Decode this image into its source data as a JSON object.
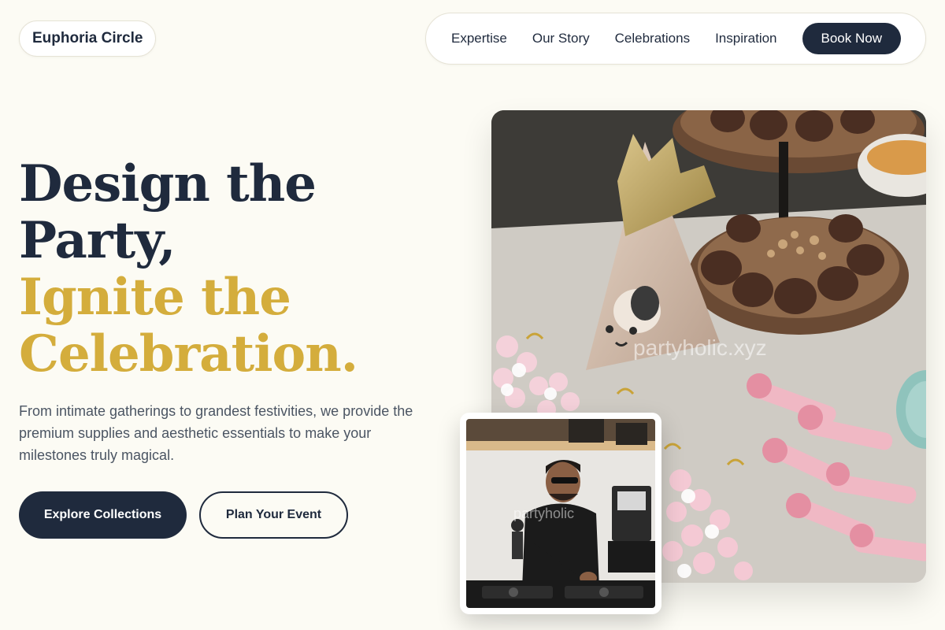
{
  "header": {
    "brand": "Euphoria Circle",
    "nav": [
      "Expertise",
      "Our Story",
      "Celebrations",
      "Inspiration"
    ],
    "cta": "Book Now"
  },
  "hero": {
    "title_line1": "Design the",
    "title_line2": "Party,",
    "title_line3": "Ignite the",
    "title_line4": "Celebration.",
    "description": "From intimate gatherings to grandest festivities, we provide the premium supplies and aesthetic essentials to make your milestones truly magical.",
    "primary_button": "Explore Collections",
    "secondary_button": "Plan Your Event"
  },
  "images": {
    "main_watermark": "partyholic.xyz",
    "dj_watermark": "partyholic"
  },
  "colors": {
    "background": "#fcfbf4",
    "navy": "#1f2a3d",
    "gold": "#d4ad3c",
    "muted_text": "#4b5563"
  }
}
